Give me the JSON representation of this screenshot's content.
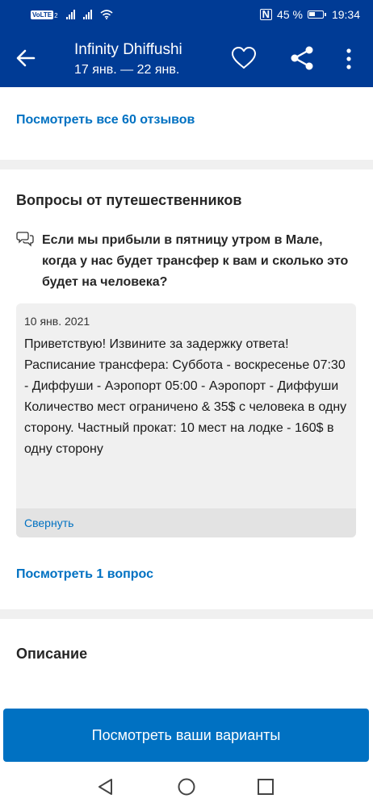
{
  "status_bar": {
    "volte": "VoLTE",
    "sim": "2",
    "nfc": "N",
    "battery": "45 %",
    "time": "19:34"
  },
  "app_bar": {
    "title": "Infinity Dhiffushi",
    "dates": "17 янв. — 22 янв.",
    "icons": [
      "back-arrow-icon",
      "heart-icon",
      "share-icon",
      "more-vertical-icon"
    ]
  },
  "reviews": {
    "link_label": "Посмотреть все 60 отзывов"
  },
  "questions": {
    "heading": "Вопросы от путешественников",
    "question_text": "Если мы прибыли в пятницу утром в Мале, когда у нас будет трансфер к вам и сколько это будет на человека?",
    "answer": {
      "date": "10 янв. 2021",
      "text": "Приветствую! Извините за задержку ответа! Расписание трансфера: Суббота - воскресенье 07:30 - Диффуши - Аэропорт 05:00 - Аэропорт - Диффуши Количество мест ограничено & 35$ с человека в одну сторону.  Частный прокат: 10 мест на лодке - 160$ в одну сторону",
      "collapse_label": "Свернуть"
    },
    "more_link": "Посмотреть 1 вопрос"
  },
  "description": {
    "heading": "Описание"
  },
  "cta": {
    "label": "Посмотреть ваши варианты"
  },
  "colors": {
    "header": "#003b95",
    "accent": "#0071c2",
    "panel": "#f0f0f0"
  }
}
